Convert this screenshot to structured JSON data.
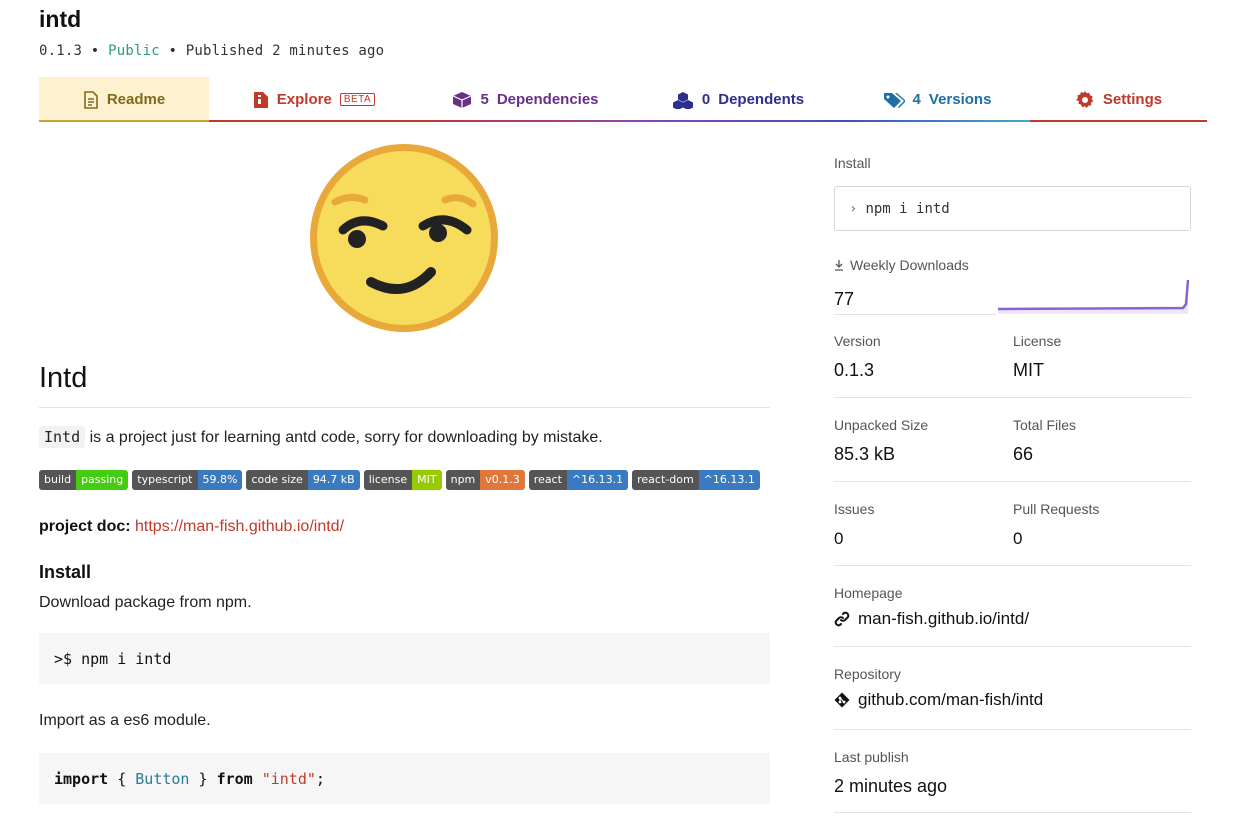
{
  "package": {
    "name": "intd",
    "version": "0.1.3",
    "sep1": "•",
    "visibility": "Public",
    "sep2": "•",
    "published": "Published 2 minutes ago"
  },
  "tabs": [
    {
      "label": "Readme",
      "icon": "file-icon",
      "color": "#826a1a"
    },
    {
      "label": "Explore",
      "badge": "BETA",
      "icon": "file-code-icon",
      "color": "#c0392b"
    },
    {
      "count": "5",
      "label": "Dependencies",
      "icon": "box-icon",
      "color": "#6b2f8a"
    },
    {
      "count": "0",
      "label": "Dependents",
      "icon": "cubes-icon",
      "color": "#2d2f8f"
    },
    {
      "count": "4",
      "label": "Versions",
      "icon": "tags-icon",
      "color": "#1d6fa5"
    },
    {
      "label": "Settings",
      "icon": "gear-icon",
      "color": "#c0392b"
    }
  ],
  "readme": {
    "emoji": "smirking-face",
    "heading": "Intd",
    "desc_code": "Intd",
    "desc_text": "is a project just for learning antd code, sorry for downloading by mistake.",
    "badges": [
      {
        "left": "build",
        "right": "passing",
        "color": "#4c1"
      },
      {
        "left": "typescript",
        "right": "59.8%",
        "color": "#3a7bbf"
      },
      {
        "left": "code size",
        "right": "94.7 kB",
        "color": "#3a7bbf"
      },
      {
        "left": "license",
        "right": "MIT",
        "color": "#97ca00"
      },
      {
        "left": "npm",
        "right": "v0.1.3",
        "color": "#e05d44"
      },
      {
        "left": "react",
        "right": "^16.13.1",
        "color": "#3a7bbf"
      },
      {
        "left": "react-dom",
        "right": "^16.13.1",
        "color": "#3a7bbf"
      }
    ],
    "doc_label": "project doc:",
    "doc_link": "https://man-fish.github.io/intd/",
    "install_heading": "Install",
    "install_text": "Download package from npm.",
    "install_cmd": ">$ npm i intd",
    "import_text": "Import as a es6 module.",
    "import_code": {
      "kw1": "import",
      "open": " { ",
      "ident": "Button",
      "close": " } ",
      "kw2": "from",
      "space": " ",
      "str": "\"intd\"",
      "semi": ";"
    }
  },
  "sidebar": {
    "install_label": "Install",
    "install_prompt": "›",
    "install_cmd": "npm i intd",
    "downloads_label": "Weekly Downloads",
    "downloads_value": "77",
    "version_label": "Version",
    "version_value": "0.1.3",
    "license_label": "License",
    "license_value": "MIT",
    "size_label": "Unpacked Size",
    "size_value": "85.3 kB",
    "files_label": "Total Files",
    "files_value": "66",
    "issues_label": "Issues",
    "issues_value": "0",
    "prs_label": "Pull Requests",
    "prs_value": "0",
    "homepage_label": "Homepage",
    "homepage_value": "man-fish.github.io/intd/",
    "repo_label": "Repository",
    "repo_value": "github.com/man-fish/intd",
    "publish_label": "Last publish",
    "publish_value": "2 minutes ago"
  },
  "colors": {
    "accent_red": "#c0392b",
    "public_green": "#2e9c6a",
    "sparkline": "#8a63d2"
  }
}
